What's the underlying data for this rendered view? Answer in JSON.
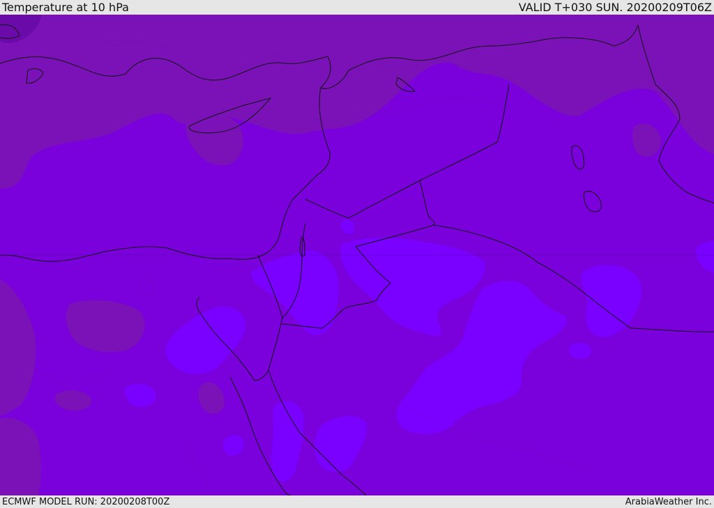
{
  "header": {
    "title": "Temperature at 10 hPa",
    "valid": "VALID T+030 SUN. 20200209T06Z"
  },
  "footer": {
    "model_run": "ECMWF MODEL RUN: 20200208T00Z",
    "credit": "ArabiaWeather Inc."
  },
  "colors": {
    "base": "#7a00dc",
    "cold": "#7a12b8",
    "colder": "#6a0aa8",
    "warm": "#7a00ff",
    "coast": "#111111",
    "background": "#e6e6e6"
  }
}
